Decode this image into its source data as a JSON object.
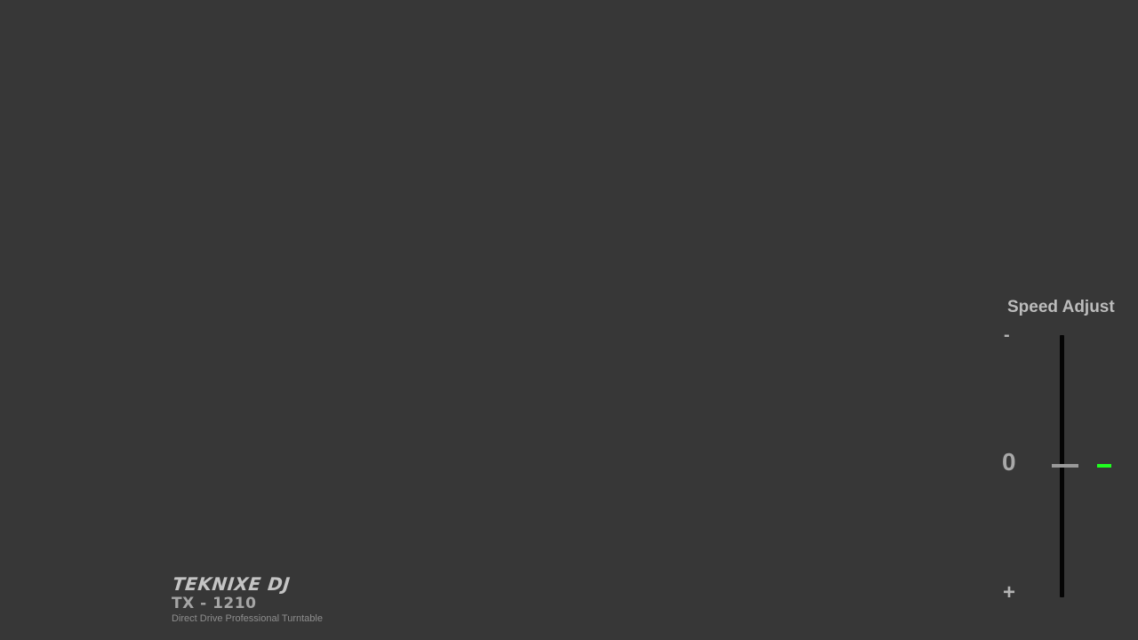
{
  "brand": {
    "name": "TEKNIXE DJ",
    "model": "TX - 1210",
    "tagline": "Direct Drive Professional Turntable"
  },
  "speed_adjust": {
    "title": "Speed Adjust",
    "min_marker": "-",
    "center_marker": "0",
    "max_marker": "+",
    "current_value": 0,
    "indicator_color": "#1fff1f"
  },
  "colors": {
    "background": "#373737",
    "track": "#050505",
    "thumb": "#9a9a9a"
  }
}
